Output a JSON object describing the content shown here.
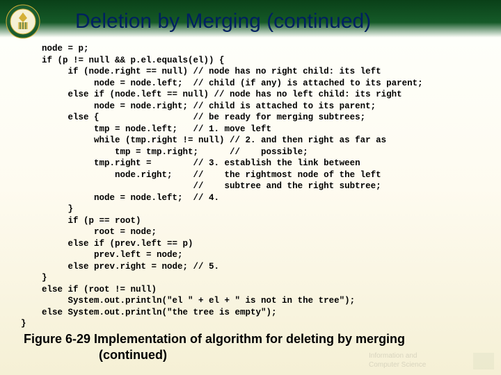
{
  "title": "Deletion by Merging (continued)",
  "code": {
    "l01": "    node = p;",
    "l02": "    if (p != null && p.el.equals(el)) {",
    "l03": "         if (node.right == null) // node has no right child: its left",
    "l04": "              node = node.left;  // child (if any) is attached to its parent;",
    "l05": "         else if (node.left == null) // node has no left child: its right",
    "l06": "              node = node.right; // child is attached to its parent;",
    "l07": "         else {                  // be ready for merging subtrees;",
    "l08": "              tmp = node.left;   // 1. move left",
    "l09": "              while (tmp.right != null) // 2. and then right as far as",
    "l10": "                  tmp = tmp.right;      //    possible;",
    "l11": "              tmp.right =        // 3. establish the link between",
    "l12": "                  node.right;    //    the rightmost node of the left",
    "l13": "                                 //    subtree and the right subtree;",
    "l14": "              node = node.left;  // 4.",
    "l15": "         }",
    "l16": "         if (p == root)",
    "l17": "              root = node;",
    "l18": "         else if (prev.left == p)",
    "l19": "              prev.left = node;",
    "l20": "         else prev.right = node; // 5.",
    "l21": "    }",
    "l22": "    else if (root != null)",
    "l23": "         System.out.println(\"el \" + el + \" is not in the tree\");",
    "l24": "    else System.out.println(\"the tree is empty\");",
    "l25": "}"
  },
  "caption_line1": "Figure 6-29 Implementation of algorithm for deleting by merging",
  "caption_line2": "(continued)"
}
